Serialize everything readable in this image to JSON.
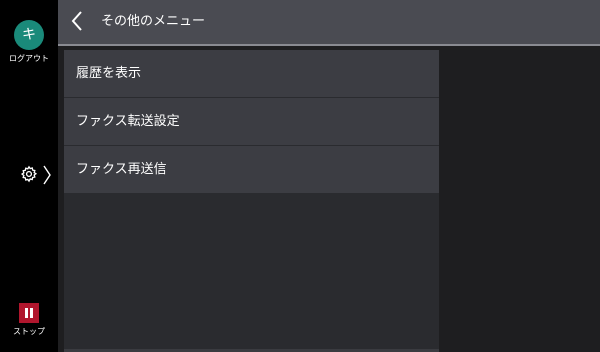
{
  "header": {
    "title": "その他のメニュー",
    "back_icon": "chevron-left-icon"
  },
  "rail": {
    "logout": {
      "avatar_letter": "キ",
      "label": "ログアウト",
      "color": "#1a8a7a"
    },
    "settings": {
      "icon": "gear-icon",
      "chevron": "〉"
    },
    "stop": {
      "label": "ストップ",
      "color": "#b0162d"
    }
  },
  "menu": {
    "items": [
      {
        "label": "履歴を表示"
      },
      {
        "label": "ファクス転送設定"
      },
      {
        "label": "ファクス再送信"
      }
    ]
  }
}
